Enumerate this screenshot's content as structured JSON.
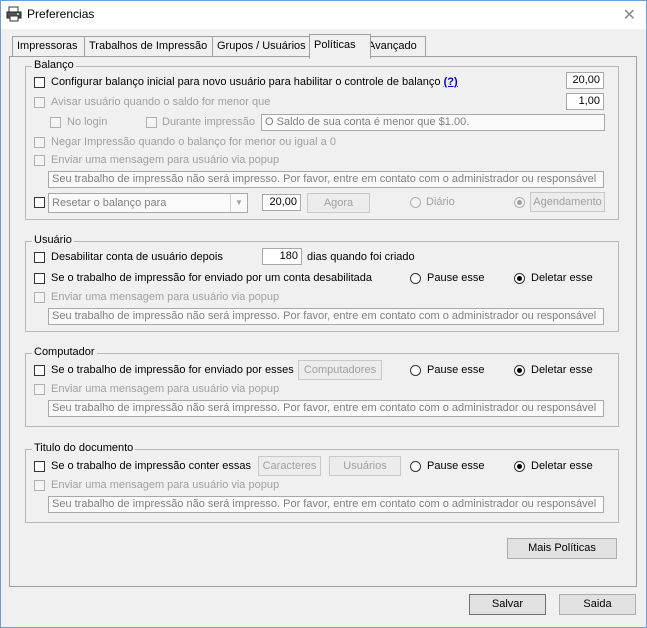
{
  "window": {
    "title": "Preferencias",
    "close_glyph": "✕",
    "app_icon": "printer-app-icon"
  },
  "tabs": [
    {
      "label": "Impressoras"
    },
    {
      "label": "Trabalhos de Impressão"
    },
    {
      "label": "Grupos / Usuários"
    },
    {
      "label": "Políticas"
    },
    {
      "label": "Avançado"
    }
  ],
  "active_tab": "Políticas",
  "balanco": {
    "title": "Balanço",
    "config_label": "Configurar balanço inicial para novo usuário para habilitar o controle de balanço",
    "help_link": "(?)",
    "initial_value": "20,00",
    "avisar_label": "Avisar usuário quando o saldo for menor que",
    "avisar_value": "1,00",
    "no_login_label": "No login",
    "durante_label": "Durante impressão",
    "warning_text": "O Saldo de sua conta é menor que $1.00.",
    "negar_label": "Negar Impressão quando o balanço for menor ou igual a 0",
    "popup_label": "Enviar uma mensagem para usuário via popup",
    "popup_text": "Seu trabalho de impressão não será impresso. Por favor, entre em contato com o administrador ou responsável",
    "reset_select": "Resetar o balanço para",
    "reset_value": "20,00",
    "agora_button": "Agora",
    "diario_label": "Diário",
    "agendamento_button": "Agendamento"
  },
  "usuario": {
    "title": "Usuário",
    "desabilitar_label": "Desabilitar conta de usuário depois",
    "days_value": "180",
    "days_suffix": "dias quando foi criado",
    "disabled_job_label": "Se o trabalho de impressão for enviado por um conta desabilitada",
    "pause_label": "Pause esse",
    "delete_label": "Deletar esse",
    "popup_label": "Enviar uma mensagem para usuário via popup",
    "popup_text": "Seu trabalho de impressão não será impresso. Por favor, entre em contato com o administrador ou responsável"
  },
  "computador": {
    "title": "Computador",
    "job_label": "Se o trabalho de impressão for enviado por esses",
    "computadores_button": "Computadores",
    "pause_label": "Pause esse",
    "delete_label": "Deletar esse",
    "popup_label": "Enviar uma mensagem para usuário via popup",
    "popup_text": "Seu trabalho de impressão não será impresso. Por favor, entre em contato com o administrador ou responsável"
  },
  "documento": {
    "title": "Titulo do documento",
    "job_label": "Se o trabalho de impressão conter essas",
    "caracteres_button": "Caracteres",
    "usuarios_button": "Usuários",
    "pause_label": "Pause esse",
    "delete_label": "Deletar esse",
    "popup_label": "Enviar uma mensagem para usuário via popup",
    "popup_text": "Seu trabalho de impressão não será impresso. Por favor, entre em contato com o administrador ou responsável"
  },
  "footer": {
    "mais_politicas": "Mais Políticas",
    "salvar": "Salvar",
    "saida": "Saida"
  }
}
